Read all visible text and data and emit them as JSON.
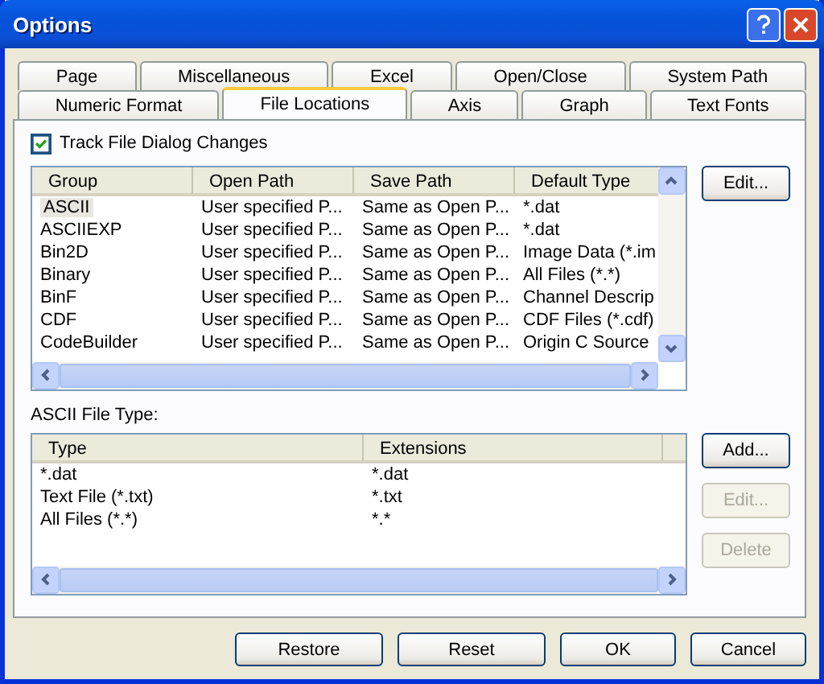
{
  "window": {
    "title": "Options"
  },
  "tab_rows": [
    [
      {
        "label": "Page",
        "selected": false
      },
      {
        "label": "Miscellaneous",
        "selected": false
      },
      {
        "label": "Excel",
        "selected": false
      },
      {
        "label": "Open/Close",
        "selected": false
      },
      {
        "label": "System Path",
        "selected": false
      }
    ],
    [
      {
        "label": "Numeric Format",
        "selected": false
      },
      {
        "label": "File Locations",
        "selected": true
      },
      {
        "label": "Axis",
        "selected": false
      },
      {
        "label": "Graph",
        "selected": false
      },
      {
        "label": "Text Fonts",
        "selected": false
      }
    ]
  ],
  "track_changes": {
    "label": "Track File Dialog Changes",
    "checked": true
  },
  "locations": {
    "columns": [
      "Group",
      "Open Path",
      "Save Path",
      "Default Type"
    ],
    "rows": [
      {
        "cells": [
          "ASCII",
          "User specified P...",
          "Same as Open P...",
          "*.dat"
        ],
        "selected": true
      },
      {
        "cells": [
          "ASCIIEXP",
          "User specified P...",
          "Same as Open P...",
          "*.dat"
        ],
        "selected": false
      },
      {
        "cells": [
          "Bin2D",
          "User specified P...",
          "Same as Open P...",
          "Image Data (*.im"
        ],
        "selected": false
      },
      {
        "cells": [
          "Binary",
          "User specified P...",
          "Same as Open P...",
          "All Files (*.*)"
        ],
        "selected": false
      },
      {
        "cells": [
          "BinF",
          "User specified P...",
          "Same as Open P...",
          "Channel Descrip"
        ],
        "selected": false
      },
      {
        "cells": [
          "CDF",
          "User specified P...",
          "Same as Open P...",
          "CDF Files (*.cdf)"
        ],
        "selected": false
      },
      {
        "cells": [
          "CodeBuilder",
          "User specified P...",
          "Same as Open P...",
          "Origin C Source"
        ],
        "selected": false
      }
    ],
    "buttons": [
      {
        "label": "Edit...",
        "disabled": false
      }
    ]
  },
  "file_type": {
    "label": "ASCII File Type:",
    "columns": [
      "Type",
      "Extensions"
    ],
    "rows": [
      {
        "cells": [
          "*.dat",
          "*.dat"
        ]
      },
      {
        "cells": [
          "Text File (*.txt)",
          "*.txt"
        ]
      },
      {
        "cells": [
          "All Files (*.*)",
          "*.*"
        ]
      }
    ],
    "buttons": [
      {
        "label": "Add...",
        "disabled": false
      },
      {
        "label": "Edit...",
        "disabled": true
      },
      {
        "label": "Delete",
        "disabled": true
      }
    ]
  },
  "buttons": [
    {
      "label": "Restore"
    },
    {
      "label": "Reset"
    },
    {
      "label": "OK"
    },
    {
      "label": "Cancel"
    }
  ]
}
